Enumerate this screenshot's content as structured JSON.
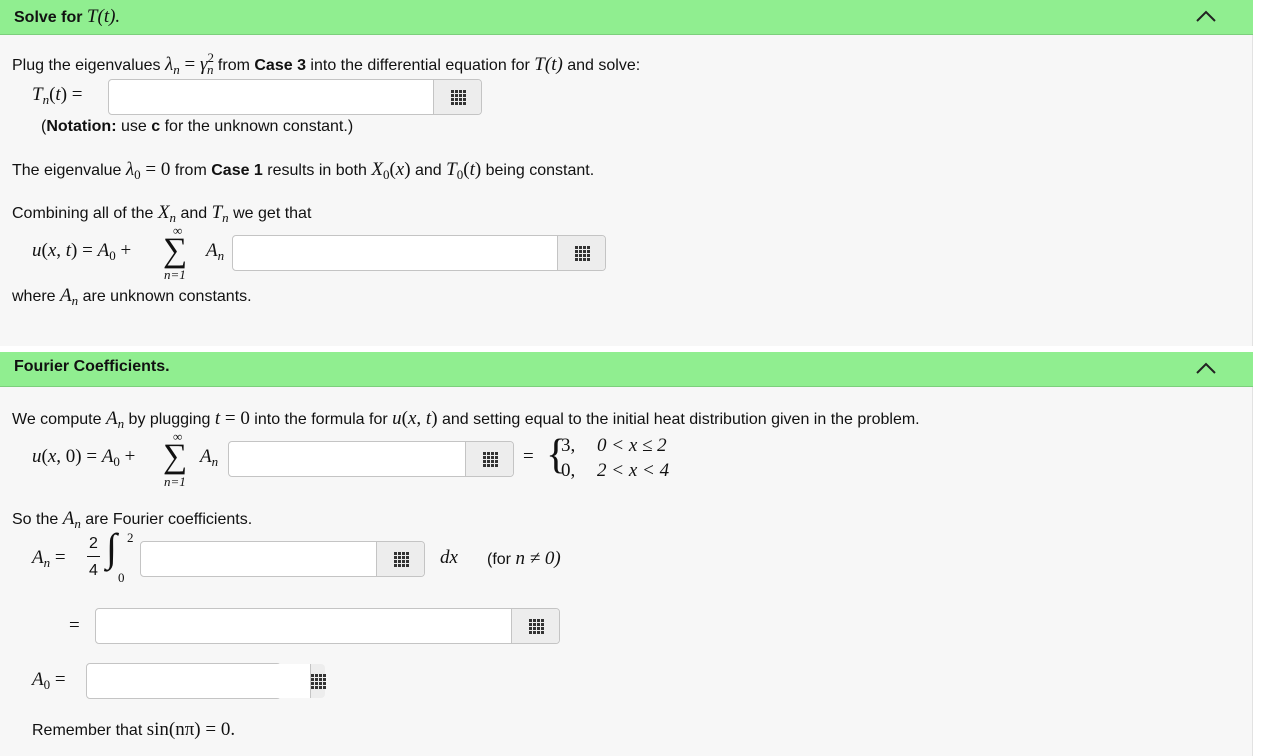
{
  "section1": {
    "title_prefix": "Solve for",
    "title_math": "T(t).",
    "intro_a": "Plug the eigenvalues",
    "intro_b": "from",
    "case3": "Case 3",
    "intro_c": "into the differential equation for",
    "intro_d": "and solve:",
    "tn_label": "T",
    "notation_open": "(",
    "notation_bold": "Notation:",
    "notation_mid": "use",
    "notation_c": "c",
    "notation_end": "for the unknown constant.)",
    "eig0_a": "The eigenvalue",
    "eig0_b": "from",
    "case1": "Case 1",
    "eig0_c": "results in both",
    "eig0_d": "and",
    "eig0_e": "being constant.",
    "combine_a": "Combining all of the",
    "combine_b": "and",
    "combine_c": "we get that",
    "where_a": "where",
    "where_b": "are unknown constants."
  },
  "section2": {
    "title": "Fourier Coefficients.",
    "compute_a": "We compute",
    "compute_b": "by plugging",
    "compute_c": "into the formula for",
    "compute_d": "and setting equal to the initial heat distribution given in the problem.",
    "piece1_val": "3,",
    "piece1_cond": "0 < x ≤ 2",
    "piece2_val": "0,",
    "piece2_cond": "2 < x < 4",
    "sothe_a": "So the",
    "sothe_b": "are Fourier coefficients.",
    "frac_num": "2",
    "frac_den": "4",
    "int_upper": "2",
    "int_lower": "0",
    "dx": "dx",
    "forn_a": "(for",
    "forn_b": "n ≠ 0)",
    "remember_a": "Remember that",
    "remember_b": "sin(nπ) = 0."
  },
  "inputs": {
    "tn_value": "",
    "series_value": "",
    "fourier_value": "",
    "integrand_value": "",
    "an_result_value": "",
    "a0_value": ""
  }
}
